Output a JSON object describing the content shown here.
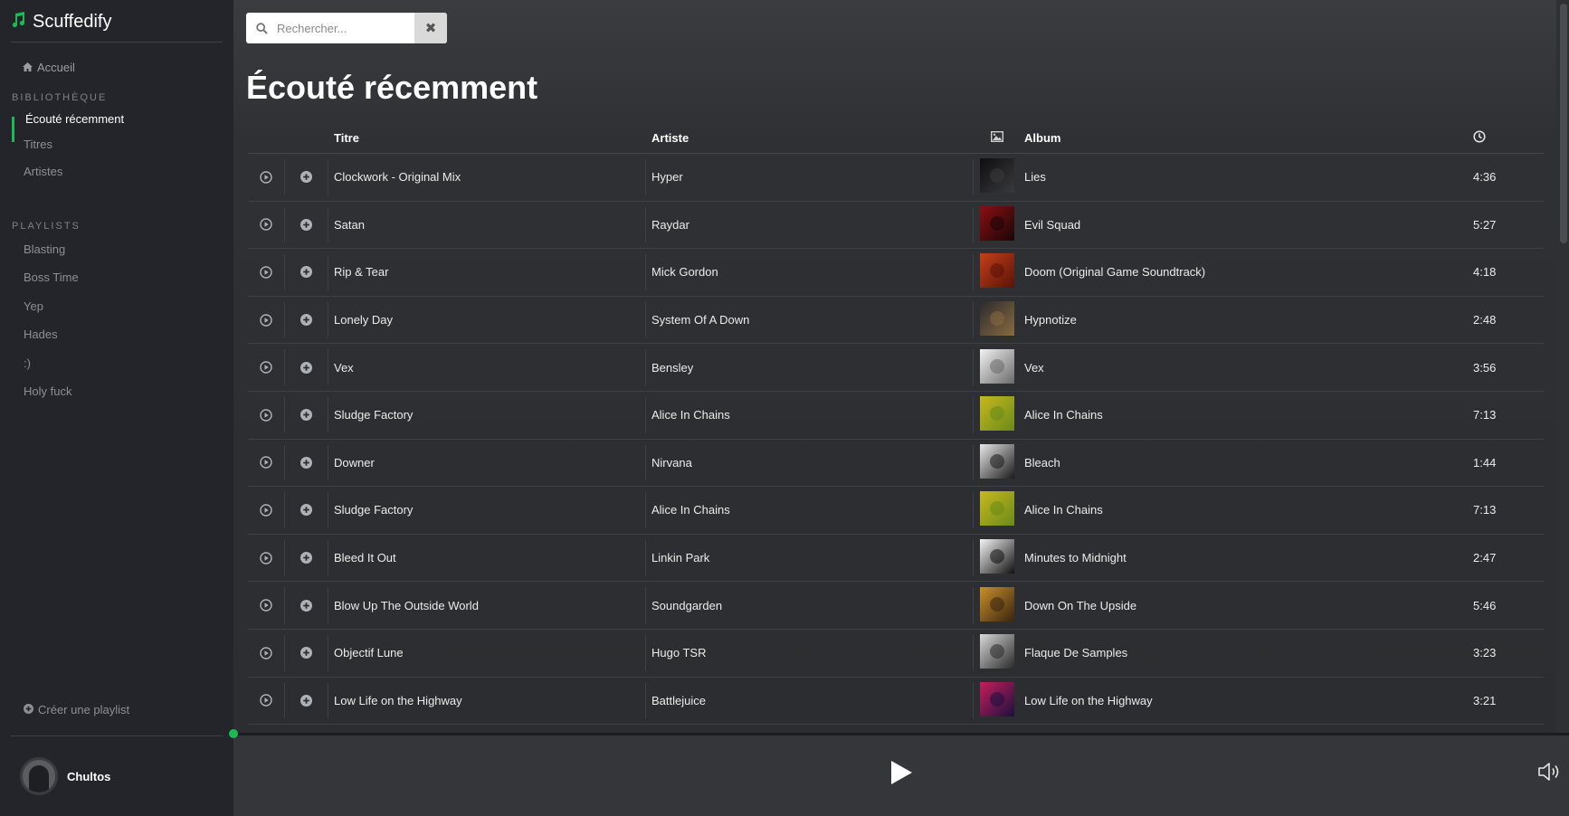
{
  "app": {
    "name": "Scuffedify",
    "accent": "#1db954"
  },
  "sidebar": {
    "home": "Accueil",
    "library_title": "BIBLIOTHÈQUE",
    "library": [
      {
        "label": "Écouté récemment",
        "active": true
      },
      {
        "label": "Titres",
        "active": false
      },
      {
        "label": "Artistes",
        "active": false
      }
    ],
    "playlists_title": "PLAYLISTS",
    "playlists": [
      "Blasting",
      "Boss Time",
      "Yep",
      "Hades",
      ":)",
      "Holy fuck"
    ],
    "create_playlist": "Créer une playlist",
    "user": "Chultos"
  },
  "search": {
    "placeholder": "Rechercher...",
    "value": ""
  },
  "main": {
    "title": "Écouté récemment",
    "columns": {
      "title": "Titre",
      "artist": "Artiste",
      "album": "Album"
    },
    "tracks": [
      {
        "title": "Clockwork - Original Mix",
        "artist": "Hyper",
        "album": "Lies",
        "duration": "4:36",
        "cover": [
          "#0e0e10",
          "#3a3a3e"
        ]
      },
      {
        "title": "Satan",
        "artist": "Raydar",
        "album": "Evil Squad",
        "duration": "5:27",
        "cover": [
          "#8a0f12",
          "#1a0608"
        ]
      },
      {
        "title": "Rip & Tear",
        "artist": "Mick Gordon",
        "album": "Doom (Original Game Soundtrack)",
        "duration": "4:18",
        "cover": [
          "#c4401a",
          "#5a1208"
        ]
      },
      {
        "title": "Lonely Day",
        "artist": "System Of A Down",
        "album": "Hypnotize",
        "duration": "2:48",
        "cover": [
          "#2a2a2e",
          "#8a6a40"
        ]
      },
      {
        "title": "Vex",
        "artist": "Bensley",
        "album": "Vex",
        "duration": "3:56",
        "cover": [
          "#f2f2f2",
          "#6a6a6a"
        ]
      },
      {
        "title": "Sludge Factory",
        "artist": "Alice In Chains",
        "album": "Alice In Chains",
        "duration": "7:13",
        "cover": [
          "#c8b820",
          "#6a8a18"
        ]
      },
      {
        "title": "Downer",
        "artist": "Nirvana",
        "album": "Bleach",
        "duration": "1:44",
        "cover": [
          "#e8e8e8",
          "#1a1a1a"
        ]
      },
      {
        "title": "Sludge Factory",
        "artist": "Alice In Chains",
        "album": "Alice In Chains",
        "duration": "7:13",
        "cover": [
          "#c8b820",
          "#6a8a18"
        ]
      },
      {
        "title": "Bleed It Out",
        "artist": "Linkin Park",
        "album": "Minutes to Midnight",
        "duration": "2:47",
        "cover": [
          "#f5f5f5",
          "#111111"
        ]
      },
      {
        "title": "Blow Up The Outside World",
        "artist": "Soundgarden",
        "album": "Down On The Upside",
        "duration": "5:46",
        "cover": [
          "#c8902a",
          "#3a2410"
        ]
      },
      {
        "title": "Objectif Lune",
        "artist": "Hugo TSR",
        "album": "Flaque De Samples",
        "duration": "3:23",
        "cover": [
          "#d8d8d8",
          "#2a2a2a"
        ]
      },
      {
        "title": "Low Life on the Highway",
        "artist": "Battlejuice",
        "album": "Low Life on the Highway",
        "duration": "3:21",
        "cover": [
          "#c81e5a",
          "#1a1040"
        ]
      }
    ]
  },
  "player": {
    "progress": 0
  }
}
